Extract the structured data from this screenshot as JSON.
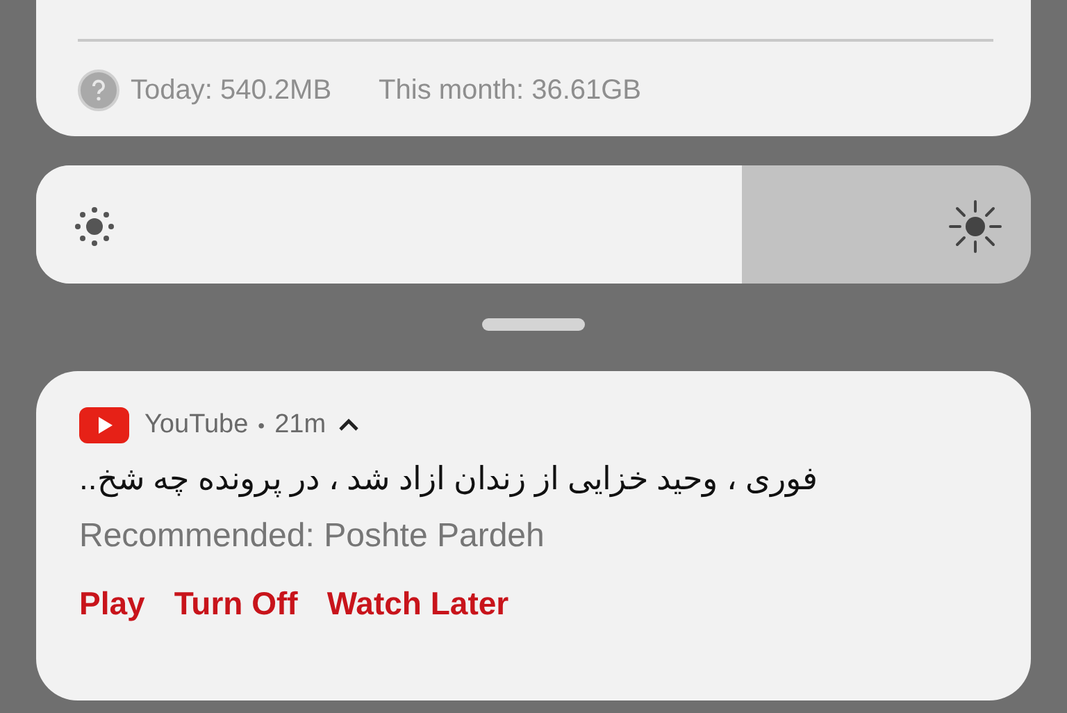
{
  "data_usage": {
    "today": "Today: 540.2MB",
    "this_month": "This month: 36.61GB"
  },
  "brightness": {
    "level": 0.71
  },
  "notification": {
    "app": "YouTube",
    "separator": "•",
    "time": "21m",
    "expanded": true,
    "title": "فوری ، وحید خزایی از زندان ازاد شد ، در پرونده چه شخ..",
    "text": "Recommended: Poshte Pardeh",
    "actions": [
      "Play",
      "Turn Off",
      "Watch Later"
    ]
  }
}
